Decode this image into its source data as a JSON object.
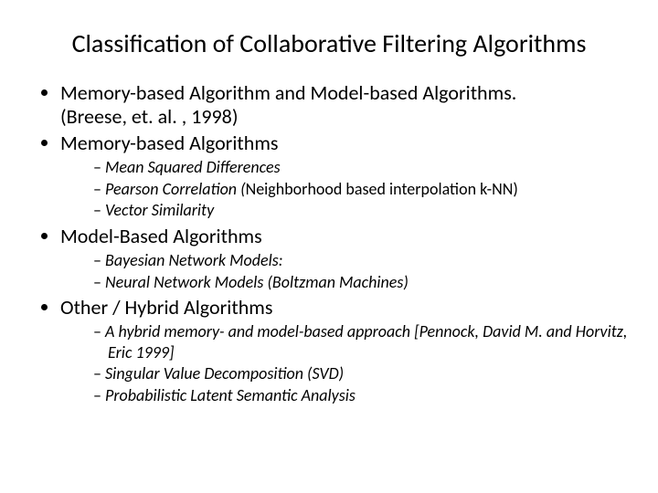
{
  "title": "Classification of Collaborative Filtering Algorithms",
  "bullets": {
    "b1_line1": "Memory-based Algorithm and Model-based Algorithms.",
    "b1_line2": "(Breese, et. al. , 1998)",
    "b2": "Memory-based Algorithms",
    "b2_sub": {
      "s1": "Mean Squared Differences",
      "s2a": "Pearson Correlation (",
      "s2b": "Neighborhood based interpolation k-NN)",
      "s3": "Vector Similarity"
    },
    "b3": "Model-Based Algorithms",
    "b3_sub": {
      "s1": "Bayesian Network Models:",
      "s2": "Neural Network Models (Boltzman Machines)"
    },
    "b4": "Other / Hybrid Algorithms",
    "b4_sub": {
      "s1": "A hybrid memory- and model-based approach [Pennock, David M. and Horvitz, Eric 1999]",
      "s2": "Singular Value Decomposition (SVD)",
      "s3": "Probabilistic Latent Semantic Analysis"
    }
  }
}
